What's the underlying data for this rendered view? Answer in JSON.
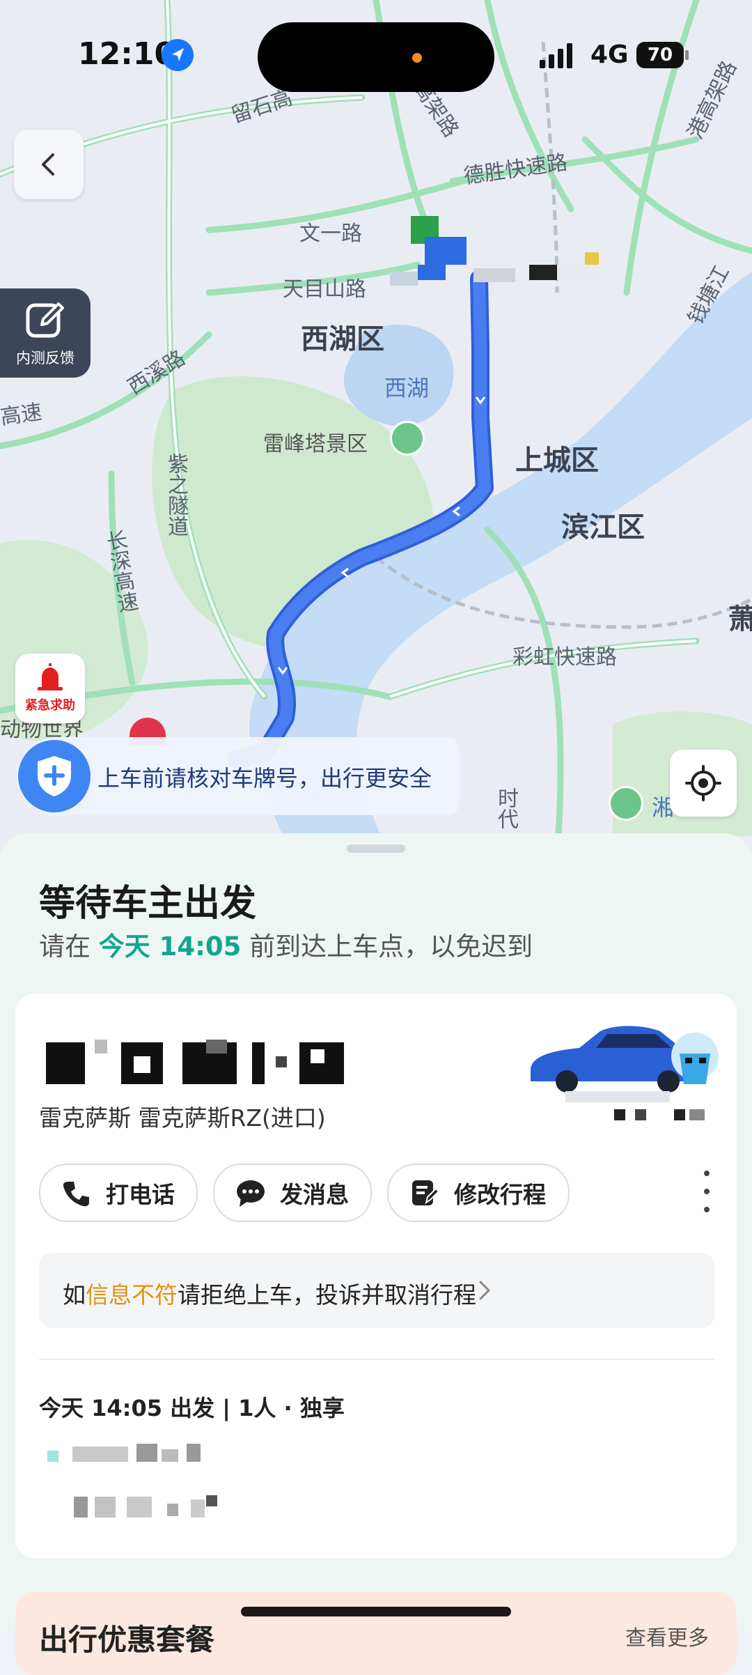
{
  "status_bar": {
    "time": "12:10",
    "network": "4G",
    "battery": "70"
  },
  "map": {
    "road_labels": [
      "留石高",
      "德胜快速路",
      "文一路",
      "天目山路",
      "西溪路",
      "高速",
      "紫之隧道",
      "长深高速",
      "彩虹快速路",
      "塘高架路",
      "时代",
      "港高架路",
      "钱塘江"
    ],
    "district_labels": [
      "西湖区",
      "上城区",
      "滨江区",
      "萧"
    ],
    "water_labels": [
      "西湖",
      "湘"
    ],
    "poi_labels": [
      "雷峰塔景区",
      "动物世界"
    ]
  },
  "feedback_button": {
    "label": "内测反馈"
  },
  "sos_button": {
    "label": "紧急求助"
  },
  "safety_notice": {
    "text": "上车前请核对车牌号，出行更安全"
  },
  "sheet": {
    "title": "等待车主出发",
    "subtitle_prefix": "请在 ",
    "subtitle_time": "今天 14:05",
    "subtitle_suffix": " 前到达上车点，以免迟到"
  },
  "driver_card": {
    "car_model": "雷克萨斯 雷克萨斯RZ(进口)",
    "actions": [
      {
        "label": "打电话",
        "icon": "phone-icon"
      },
      {
        "label": "发消息",
        "icon": "message-icon"
      },
      {
        "label": "修改行程",
        "icon": "edit-trip-icon"
      }
    ],
    "warning_prefix": "如",
    "warning_highlight": "信息不符",
    "warning_suffix": "请拒绝上车，投诉并取消行程",
    "trip_info": "今天 14:05 出发 | 1人 · 独享"
  },
  "promo": {
    "title": "出行优惠套餐",
    "more": "查看更多"
  },
  "colors": {
    "accent_teal": "#14a58e",
    "warning_orange": "#e09212",
    "route_blue": "#3f6fe8",
    "notice_blue": "#1f3a78"
  }
}
